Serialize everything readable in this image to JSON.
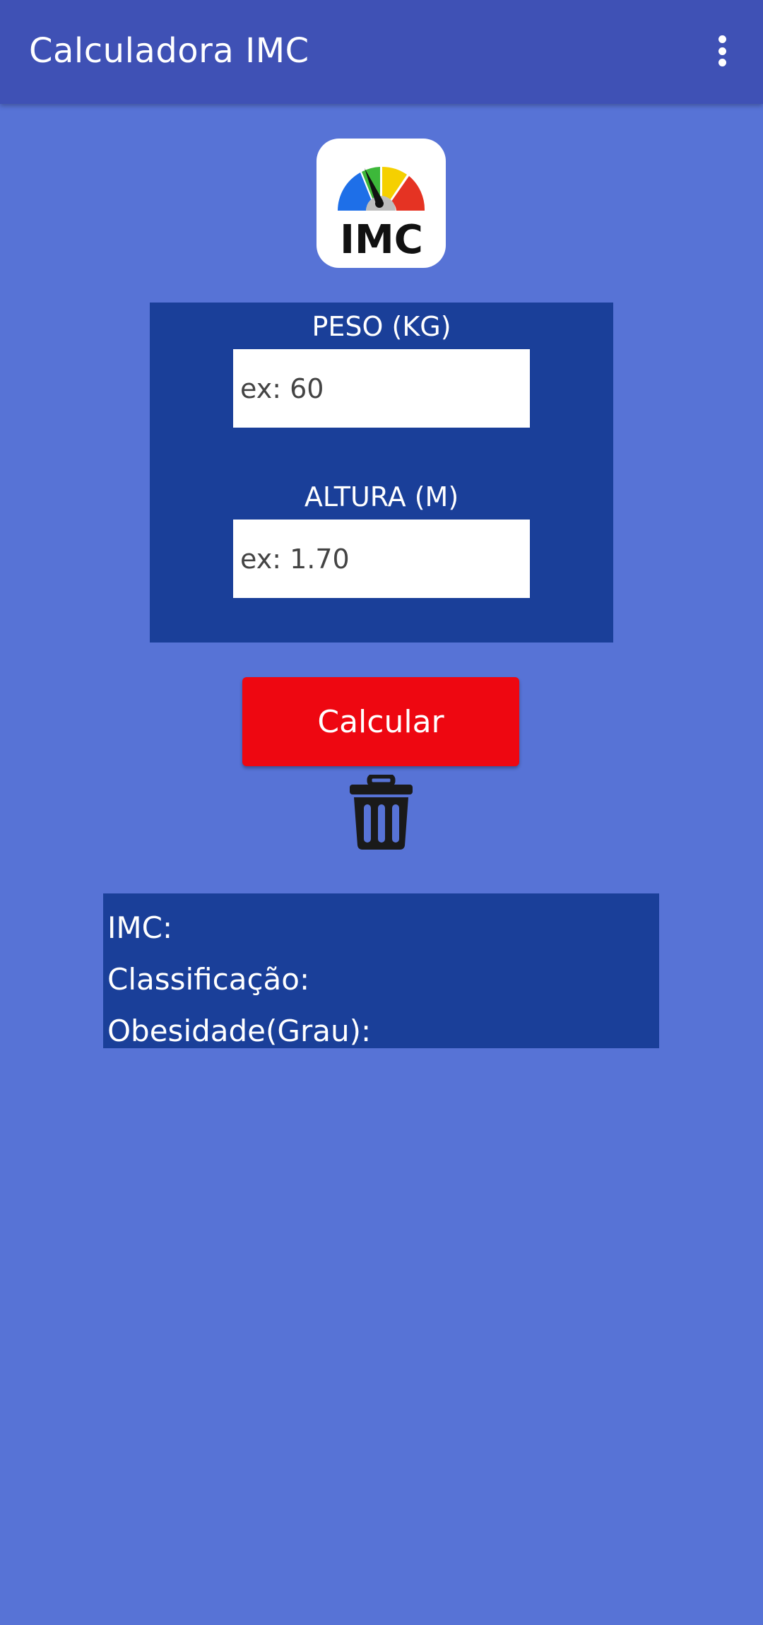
{
  "app_bar": {
    "title": "Calculadora IMC",
    "menu_icon": "more-vert-icon"
  },
  "logo": {
    "text": "IMC",
    "icon": "gauge-icon",
    "colors": [
      "#1E6FE8",
      "#3DB83A",
      "#F5D000",
      "#E53323"
    ]
  },
  "form": {
    "weight_label": "PESO (KG)",
    "weight_placeholder": "ex: 60",
    "height_label": "ALTURA (M)",
    "height_placeholder": "ex: 1.70"
  },
  "actions": {
    "calculate_label": "Calcular",
    "clear_icon": "trash-icon"
  },
  "result": {
    "imc_label": "IMC:",
    "classification_label": "Classificação:",
    "obesity_label": "Obesidade(Grau):"
  },
  "colors": {
    "app_bar": "#3F51B5",
    "background": "#5773D6",
    "panel": "#1A3F99",
    "button": "#EE0711"
  }
}
